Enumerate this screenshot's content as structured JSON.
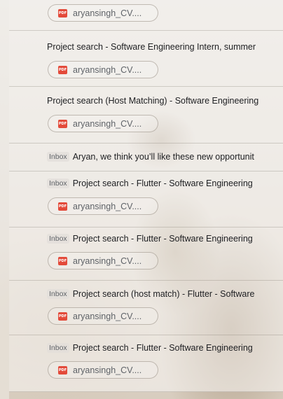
{
  "emails": [
    {
      "has_inbox_badge": false,
      "subject": "",
      "attachment": "aryansingh_CV...."
    },
    {
      "has_inbox_badge": false,
      "subject": "Project search - Software Engineering Intern, summer",
      "attachment": "aryansingh_CV...."
    },
    {
      "has_inbox_badge": false,
      "subject": "Project search (Host Matching) - Software Engineering",
      "attachment": "aryansingh_CV...."
    },
    {
      "has_inbox_badge": true,
      "subject": "Aryan, we think you’ll like these new opportunit",
      "attachment": ""
    },
    {
      "has_inbox_badge": true,
      "subject": "Project search - Flutter - Software Engineering",
      "attachment": "aryansingh_CV...."
    },
    {
      "has_inbox_badge": true,
      "subject": "Project search - Flutter - Software Engineering",
      "attachment": "aryansingh_CV...."
    },
    {
      "has_inbox_badge": true,
      "subject": "Project search (host match) - Flutter - Software",
      "attachment": "aryansingh_CV...."
    },
    {
      "has_inbox_badge": true,
      "subject": "Project search - Flutter - Software Engineering",
      "attachment": "aryansingh_CV...."
    }
  ],
  "labels": {
    "inbox": "Inbox",
    "pdf": "PDF"
  },
  "colors": {
    "pdf_red": "#e34a3a",
    "text_primary": "#202124",
    "text_secondary": "#5f6368"
  }
}
